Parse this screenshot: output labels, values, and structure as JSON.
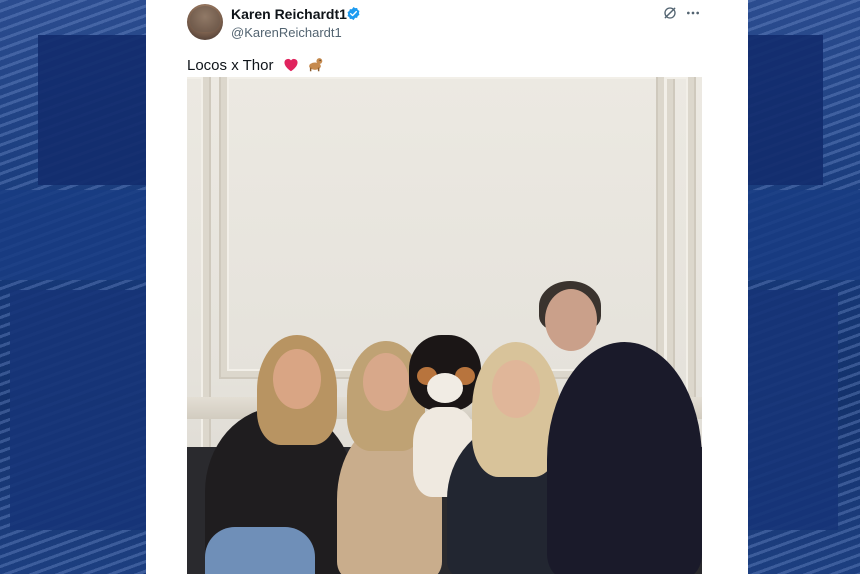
{
  "tweet": {
    "display_name": "Karen Reichardt1",
    "handle": "@KarenReichardt1",
    "text": "Locos x Thor",
    "emojis": [
      "red-heart",
      "dog"
    ]
  },
  "icons": {
    "verified": "verified-badge-icon",
    "grok": "grok-icon",
    "more": "more-icon"
  },
  "colors": {
    "verified_blue": "#1d9bf0",
    "background_blue": "#173a7a",
    "text_primary": "#0f1419",
    "text_secondary": "#536471"
  }
}
